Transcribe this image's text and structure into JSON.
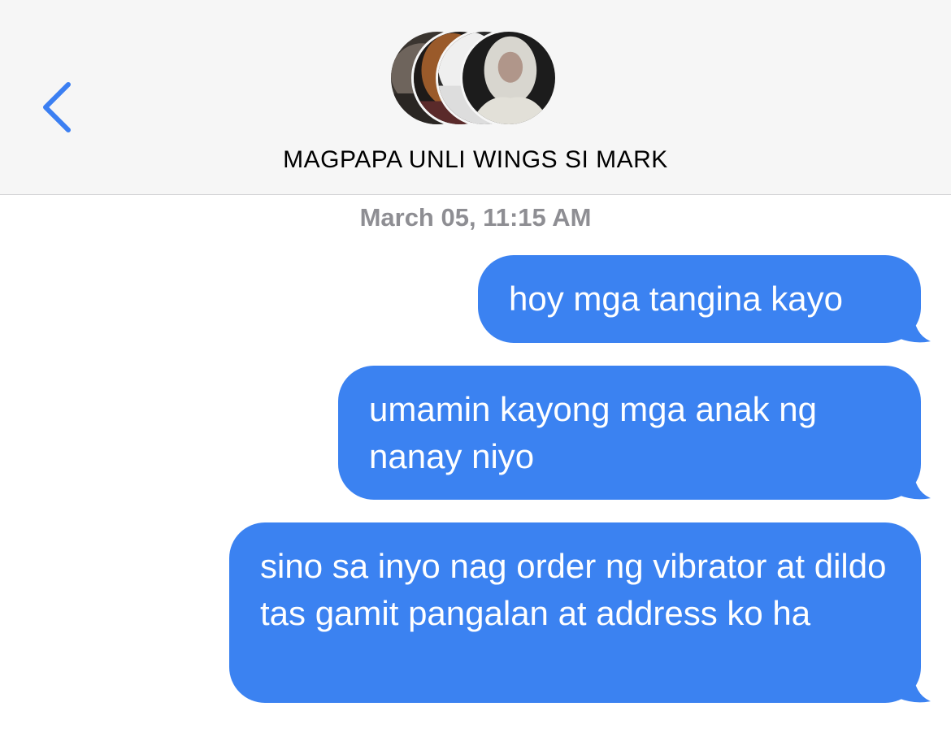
{
  "header": {
    "title": "MAGPAPA UNLI WINGS SI MARK",
    "back_icon": "chevron-left-icon",
    "accent_color": "#3b7ff2",
    "avatars": [
      "group-member-avatar-1",
      "group-member-avatar-2",
      "group-member-avatar-3",
      "group-member-avatar-4"
    ]
  },
  "conversation": {
    "timestamp": "March 05, 11:15 AM",
    "bubble_color": "#3b82f1",
    "messages": [
      {
        "sender": "me",
        "text": "hoy mga tangina kayo"
      },
      {
        "sender": "me",
        "text": "umamin kayong mga anak ng nanay niyo"
      },
      {
        "sender": "me",
        "text": "sino sa inyo nag order ng vibrator at dildo tas gamit pangalan at address ko ha"
      }
    ]
  }
}
